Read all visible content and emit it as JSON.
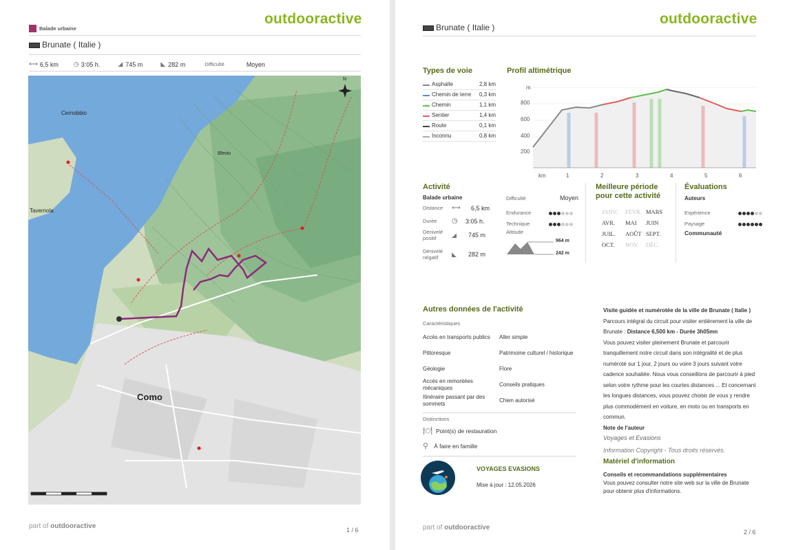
{
  "brand": "outdooractive",
  "page1": {
    "category": "Balade urbaine",
    "title": "Brunate ( Italie )",
    "stats": {
      "distance": "6,5 km",
      "duration": "3:05 h.",
      "ascent": "745 m",
      "descent": "282 m",
      "difficulty_label": "Difficulté",
      "difficulty_value": "Moyen"
    },
    "map_labels": {
      "city": "Como",
      "cernobbio": "Cernobbio",
      "tavernola": "Tavernola",
      "blevio": "Blevio",
      "north": "N"
    },
    "footer_part": "part of",
    "footer_brand": "outdooractive",
    "page_number": "1 / 6"
  },
  "page2": {
    "title": "Brunate ( Italie )",
    "types_de_voie": {
      "title": "Types de voie",
      "items": [
        {
          "name": "Asphalte",
          "value": "2,8 km",
          "color": "#888888"
        },
        {
          "name": "Chemin de terre",
          "value": "0,3 km",
          "color": "#5a8bd6"
        },
        {
          "name": "Chemin",
          "value": "1,1 km",
          "color": "#5cbf4a"
        },
        {
          "name": "Sentier",
          "value": "1,4 km",
          "color": "#e55a5a"
        },
        {
          "name": "Route",
          "value": "0,1 km",
          "color": "#444444"
        },
        {
          "name": "Inconnu",
          "value": "0,8 km",
          "color": "#aaaaaa"
        }
      ]
    },
    "profil": {
      "title": "Profil altimétrique",
      "unit_y": "m",
      "unit_x": "km",
      "y_ticks": [
        "800",
        "600",
        "400",
        "200"
      ],
      "x_ticks": [
        "1",
        "2",
        "3",
        "4",
        "5",
        "6"
      ]
    },
    "activite": {
      "title": "Activité",
      "type": "Balade urbaine",
      "distance_label": "Distance",
      "distance_value": "6,5 km",
      "duree_label": "Durée",
      "duree_value": "3:05 h.",
      "denivele_positif_label": "Dénivelé positif",
      "denivele_positif_value": "745 m",
      "denivele_negatif_label": "Dénivelé négatif",
      "denivele_negatif_value": "282 m",
      "difficulte_label": "Difficulté",
      "difficulte_value": "Moyen",
      "endurance_label": "Endurance",
      "endurance_level": 3,
      "technique_label": "Technique",
      "technique_level": 3,
      "altitude_label": "Altitude",
      "altitude_max": "964 m",
      "altitude_min": "242 m"
    },
    "periode": {
      "title": "Meilleure période pour cette activité",
      "months": [
        {
          "name": "JANV.",
          "active": false
        },
        {
          "name": "FÉVR.",
          "active": false
        },
        {
          "name": "MARS",
          "active": true
        },
        {
          "name": "AVR.",
          "active": true
        },
        {
          "name": "MAI",
          "active": true
        },
        {
          "name": "JUIN",
          "active": true
        },
        {
          "name": "JUIL.",
          "active": true
        },
        {
          "name": "AOÛT",
          "active": true
        },
        {
          "name": "SEPT.",
          "active": true
        },
        {
          "name": "OCT.",
          "active": true
        },
        {
          "name": "NOV.",
          "active": false
        },
        {
          "name": "DÉC.",
          "active": false
        }
      ]
    },
    "evaluations": {
      "title": "Évaluations",
      "auteurs": "Auteurs",
      "experience_label": "Expérience",
      "experience_level": 4,
      "paysage_label": "Paysage",
      "paysage_level": 6,
      "communaute": "Communauté"
    },
    "autres": {
      "title": "Autres données de l'activité",
      "caracteristiques_label": "Caractéristiques",
      "left": [
        "Accès en transports publics",
        "Pittoresque",
        "Géologie",
        "Accès en remontées mécaniques",
        "Itinéraire passant par des sommets"
      ],
      "right": [
        "Aller simple",
        "Patrimoine culturel / historique",
        "Flore",
        "Conseils pratiques",
        "Chien autorisé"
      ],
      "distinctions_label": "Distinctions",
      "distinctions": [
        "Point(s) de restauration",
        "À faire en famille"
      ]
    },
    "author_box": {
      "name": "VOYAGES EVASIONS",
      "updated": "Mise à jour : 12.05.2026"
    },
    "description": {
      "heading": "Visite guidée et numérotée de la ville de Brunate ( Italie )",
      "p1_start": "Parcours intégral du circuit pour visiter entièrement la ville de Brunate : ",
      "p1_bold": "Distance 6,500 km - Durée 3h05mn",
      "p2": "Vous pouvez visiter pleinement Brunate et parcourir tranquillement notre circuit dans son intégralité et de plus numéroté sur 1 jour, 2 jours ou voire 3 jours suivant votre cadence souhaitée. Nous vous conseillons de parcourir à pied selon votre rythme pour les courtes distances ... Et concernant les longues distances, vous pouvez choisir de vous y rendre plus commodément en voiture, en moto ou en transports en commun.",
      "note_label": "Note de l'auteur",
      "note_author": "Voyages et Evasions",
      "copyright": "Information Copyright - Tous droits réservés.",
      "materiel_title": "Matériel d'information",
      "conseils_title": "Conseils et recommandations supplémentaires",
      "conseils_text": "Vous pouvez consulter notre site web sur la ville de Brunate pour obtenir plus d'informations."
    },
    "footer_part": "part of",
    "footer_brand": "outdooractive",
    "page_number": "2 / 6"
  }
}
